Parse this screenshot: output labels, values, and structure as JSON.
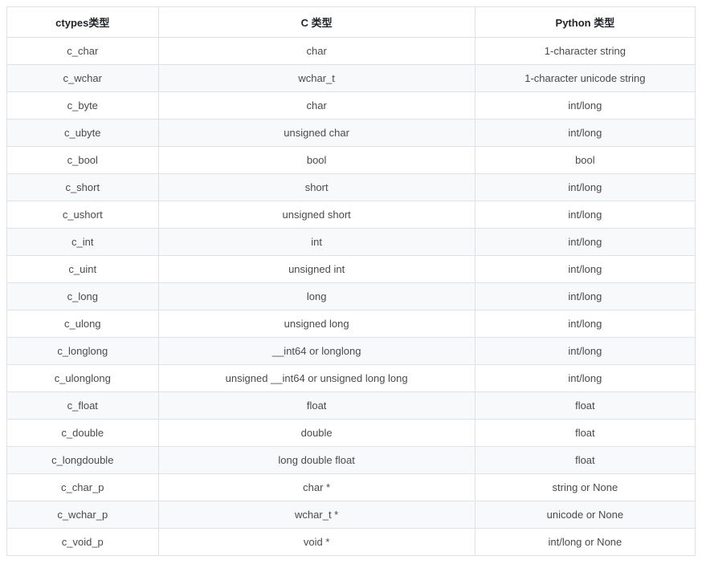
{
  "table": {
    "headers": [
      "ctypes类型",
      "C 类型",
      "Python 类型"
    ],
    "rows": [
      [
        "c_char",
        "char",
        "1-character string"
      ],
      [
        "c_wchar",
        "wchar_t",
        "1-character unicode string"
      ],
      [
        "c_byte",
        "char",
        "int/long"
      ],
      [
        "c_ubyte",
        "unsigned char",
        "int/long"
      ],
      [
        "c_bool",
        "bool",
        "bool"
      ],
      [
        "c_short",
        "short",
        "int/long"
      ],
      [
        "c_ushort",
        "unsigned short",
        "int/long"
      ],
      [
        "c_int",
        "int",
        "int/long"
      ],
      [
        "c_uint",
        "unsigned int",
        "int/long"
      ],
      [
        "c_long",
        "long",
        "int/long"
      ],
      [
        "c_ulong",
        "unsigned long",
        "int/long"
      ],
      [
        "c_longlong",
        "__int64 or longlong",
        "int/long"
      ],
      [
        "c_ulonglong",
        "unsigned __int64 or unsigned long long",
        "int/long"
      ],
      [
        "c_float",
        "float",
        "float"
      ],
      [
        "c_double",
        "double",
        "float"
      ],
      [
        "c_longdouble",
        "long double float",
        "float"
      ],
      [
        "c_char_p",
        "char *",
        "string or None"
      ],
      [
        "c_wchar_p",
        "wchar_t *",
        "unicode or None"
      ],
      [
        "c_void_p",
        "void *",
        "int/long or None"
      ]
    ]
  }
}
